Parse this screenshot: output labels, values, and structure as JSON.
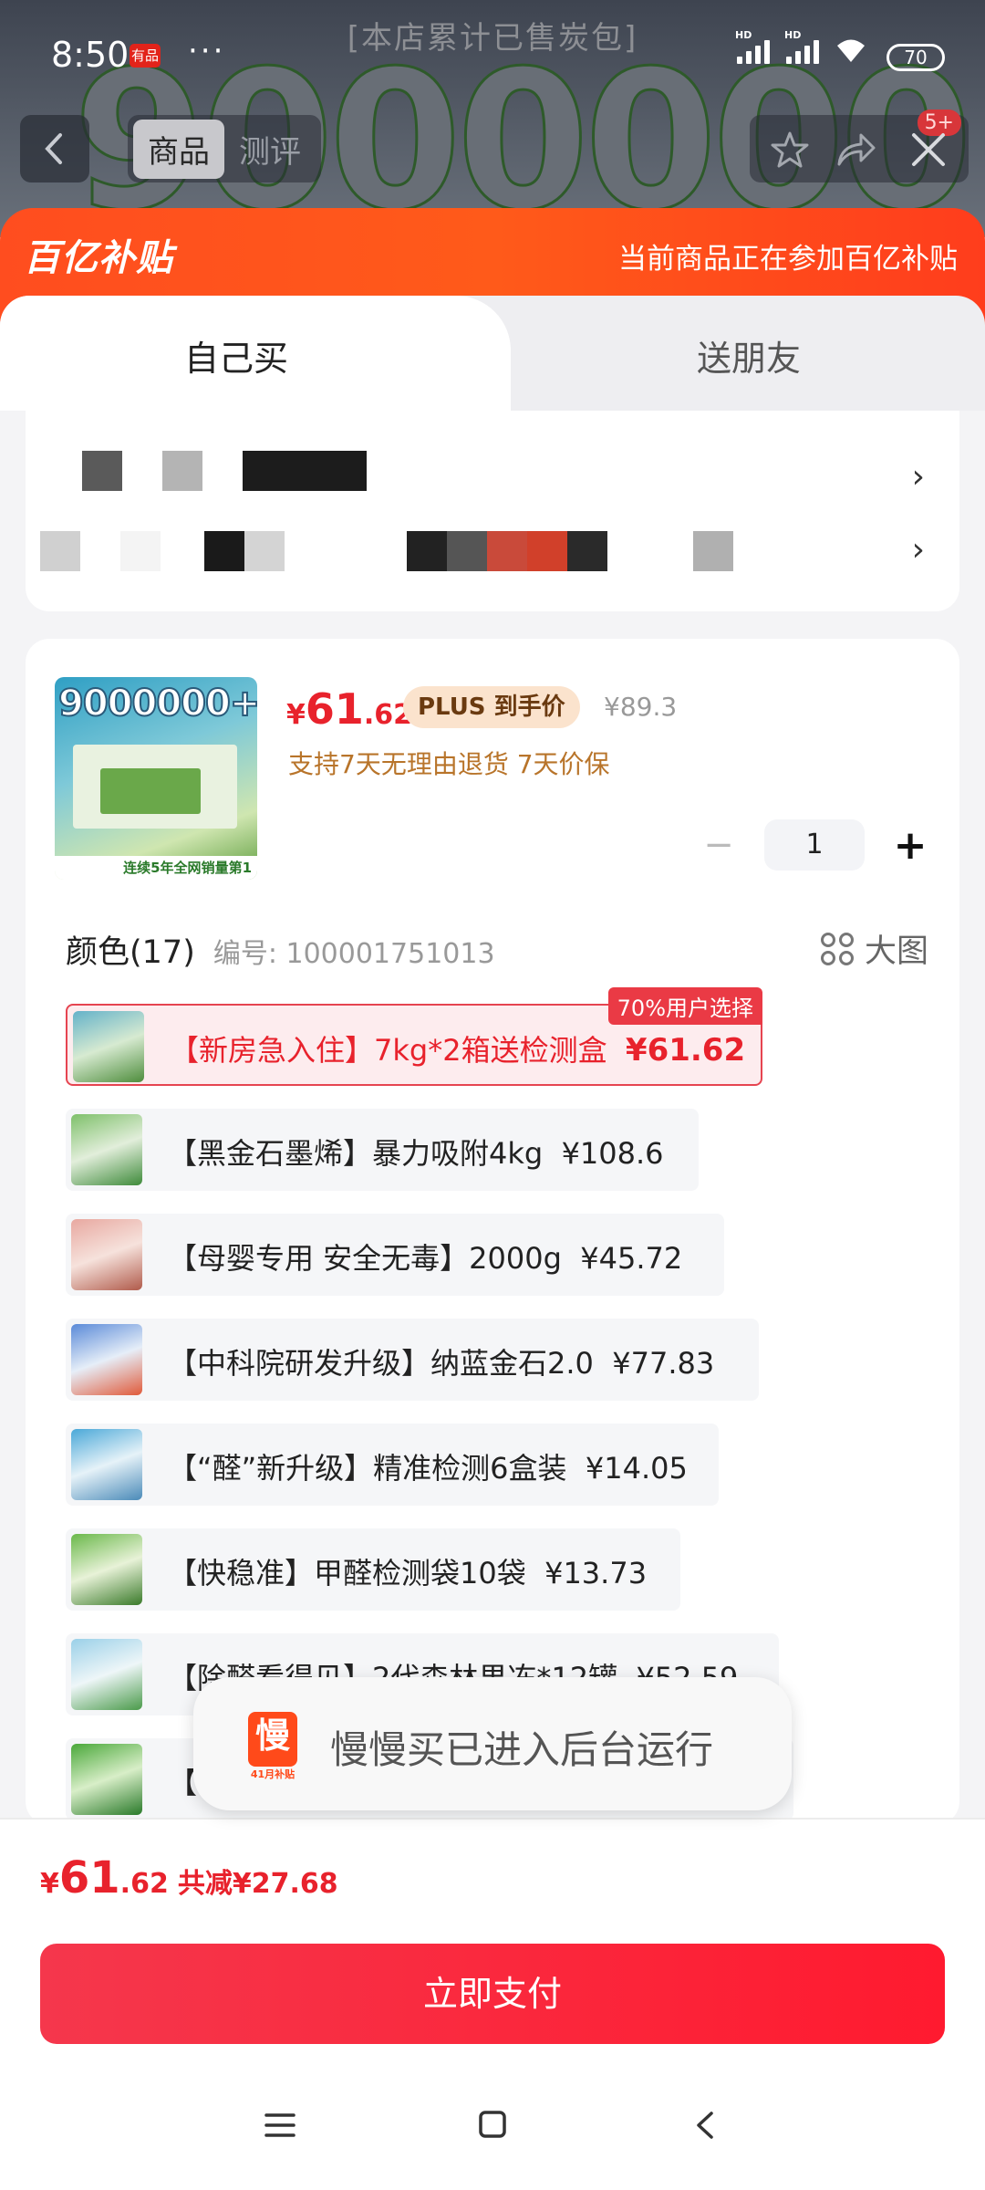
{
  "status_bar": {
    "time": "8:50",
    "app_badge": "有品",
    "dots": "···",
    "battery": "70"
  },
  "background": {
    "banner": "[本店累计已售炭包]",
    "big_number": "9000000+"
  },
  "top_nav": {
    "tab_product": "商品",
    "tab_review": "测评",
    "badge": "5+"
  },
  "subsidy": {
    "logo": "百亿补贴",
    "note": "当前商品正在参加百亿补贴"
  },
  "mode_tabs": {
    "self": "自己买",
    "gift": "送朋友"
  },
  "address": {
    "arrow": "›"
  },
  "product": {
    "thumb_title": "9000000+",
    "thumb_strip": "连续5年全网销量第1",
    "price_symbol": "¥",
    "price_int": "61",
    "price_dec": ".62",
    "plus_label": "PLUS 到手价",
    "original_price": "¥89.3",
    "service": "支持7天无理由退货  7天价保",
    "quantity": "1",
    "minus": "−",
    "plus": "+"
  },
  "spec": {
    "title": "颜色(17)",
    "code": "编号: 100001751013",
    "big_image": "大图",
    "options": [
      {
        "label": "【新房急入住】7kg*2箱送检测盒",
        "price": "¥61.62",
        "selected": true,
        "tag": "70%用户选择"
      },
      {
        "label": "【黑金石墨烯】暴力吸附4kg",
        "price": "¥108.6"
      },
      {
        "label": "【母婴专用 安全无毒】2000g",
        "price": "¥45.72"
      },
      {
        "label": "【中科院研发升级】纳蓝金石2.0",
        "price": "¥77.83"
      },
      {
        "label": "【“醛”新升级】精准检测6盒装",
        "price": "¥14.05"
      },
      {
        "label": "【快稳准】甲醛检测袋10袋",
        "price": "¥13.73"
      },
      {
        "label": "【除醛看得见】2代森林果冻*12罐",
        "price": "¥52.59"
      },
      {
        "label": "【",
        "price": ""
      }
    ]
  },
  "toast": {
    "icon_text": "慢",
    "icon_sub": "41月补贴",
    "text": "慢慢买已进入后台运行"
  },
  "footer": {
    "price_symbol": "¥",
    "price_int": "61",
    "price_dec": ".62",
    "saved": "共减¥27.68",
    "pay_button": "立即支付"
  },
  "colors": {
    "accent": "#e8222c",
    "subsidy_orange": "#ff4d1f",
    "pay_red": "#ff1a2f"
  }
}
